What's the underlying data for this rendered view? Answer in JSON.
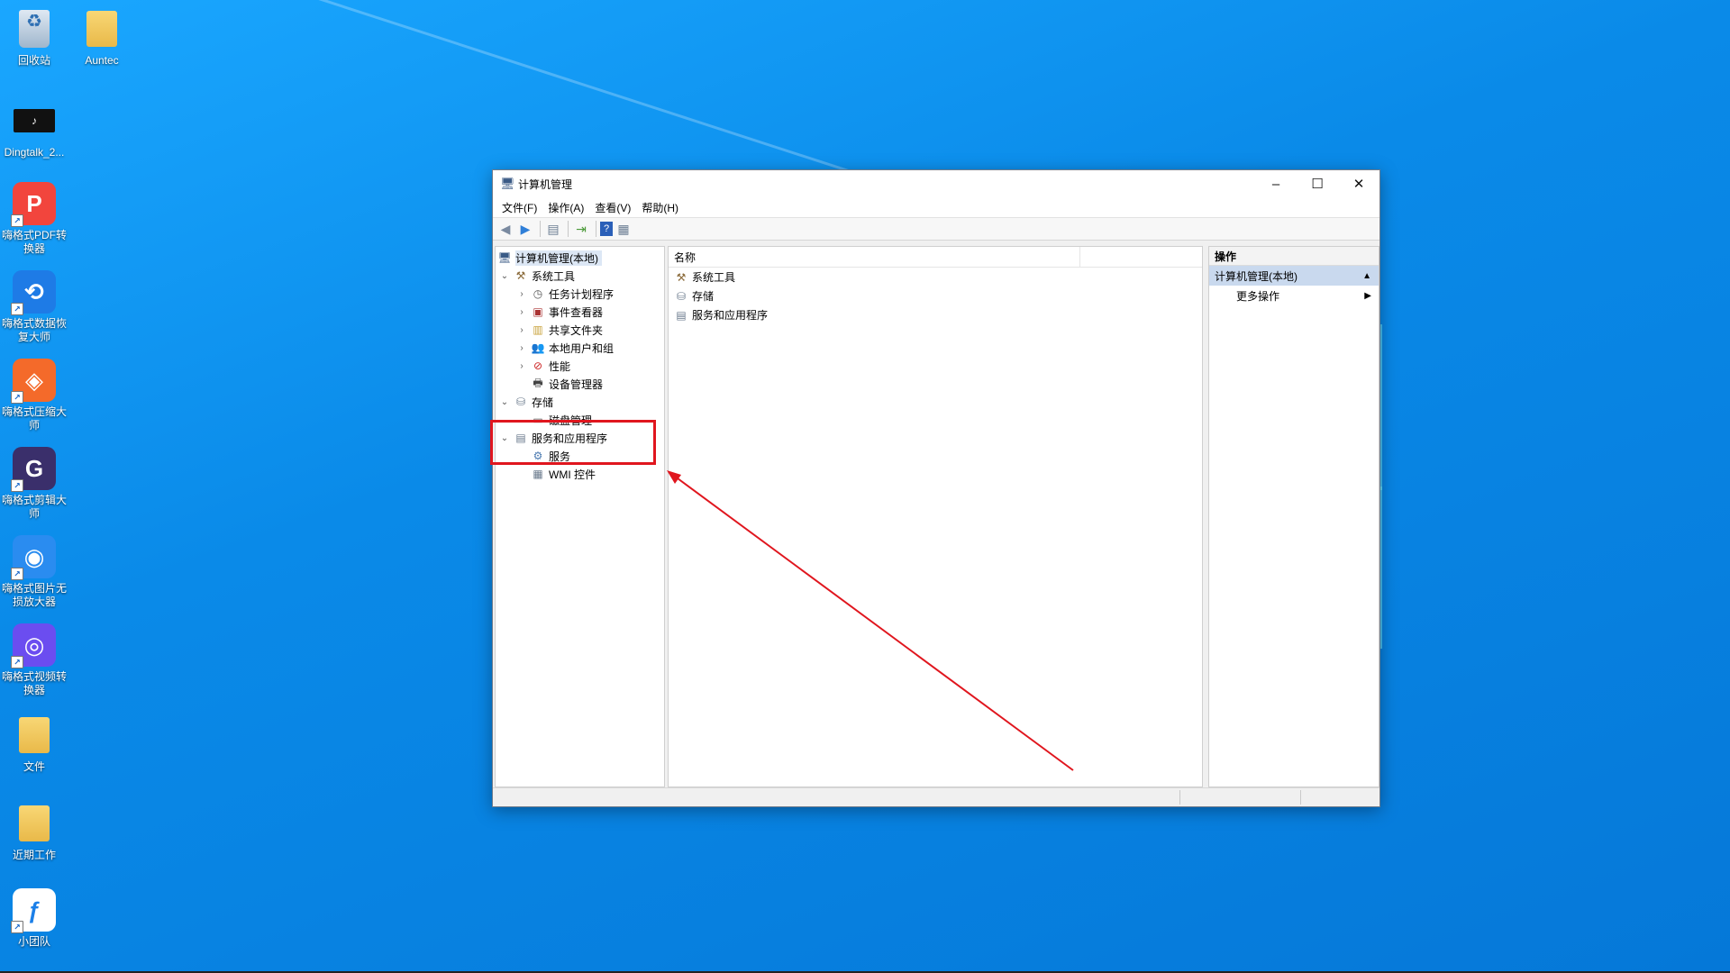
{
  "desktop": {
    "icons": [
      {
        "label": "回收站",
        "icon": "recycle-bin-icon"
      },
      {
        "label": "Auntec",
        "icon": "folder-icon"
      },
      {
        "label": "Dingtalk_2...",
        "icon": "tiktok-video-icon"
      },
      {
        "label": "嗨格式PDF转换器",
        "icon": "pdf-converter-icon",
        "color": "#f2453d"
      },
      {
        "label": "嗨格式数据恢复大师",
        "icon": "data-recovery-icon",
        "color": "#1e7be6"
      },
      {
        "label": "嗨格式压缩大师",
        "icon": "compress-icon",
        "color": "#f46a2a"
      },
      {
        "label": "嗨格式剪辑大师",
        "icon": "video-edit-icon",
        "color": "#3a2f6b"
      },
      {
        "label": "嗨格式图片无损放大器",
        "icon": "image-upscale-icon",
        "color": "#2a8cf0"
      },
      {
        "label": "嗨格式视频转换器",
        "icon": "video-converter-icon",
        "color": "#6b4df0"
      },
      {
        "label": "文件",
        "icon": "folder-icon"
      },
      {
        "label": "近期工作",
        "icon": "folder-icon"
      },
      {
        "label": "小团队",
        "icon": "team-app-icon",
        "color": "#1b7fe8"
      }
    ]
  },
  "window": {
    "title": "计算机管理",
    "menu": [
      "文件(F)",
      "操作(A)",
      "查看(V)",
      "帮助(H)"
    ],
    "tree": {
      "root": "计算机管理(本地)",
      "system_tools": "系统工具",
      "task_scheduler": "任务计划程序",
      "event_viewer": "事件查看器",
      "shared_folders": "共享文件夹",
      "local_users": "本地用户和组",
      "performance": "性能",
      "device_manager": "设备管理器",
      "storage": "存储",
      "disk_management": "磁盘管理",
      "services_apps": "服务和应用程序",
      "services": "服务",
      "wmi": "WMI 控件"
    },
    "main": {
      "column_name": "名称",
      "items": [
        "系统工具",
        "存储",
        "服务和应用程序"
      ]
    },
    "actions": {
      "header": "操作",
      "section": "计算机管理(本地)",
      "more": "更多操作"
    }
  },
  "annotation": {
    "color": "#e0161e"
  }
}
